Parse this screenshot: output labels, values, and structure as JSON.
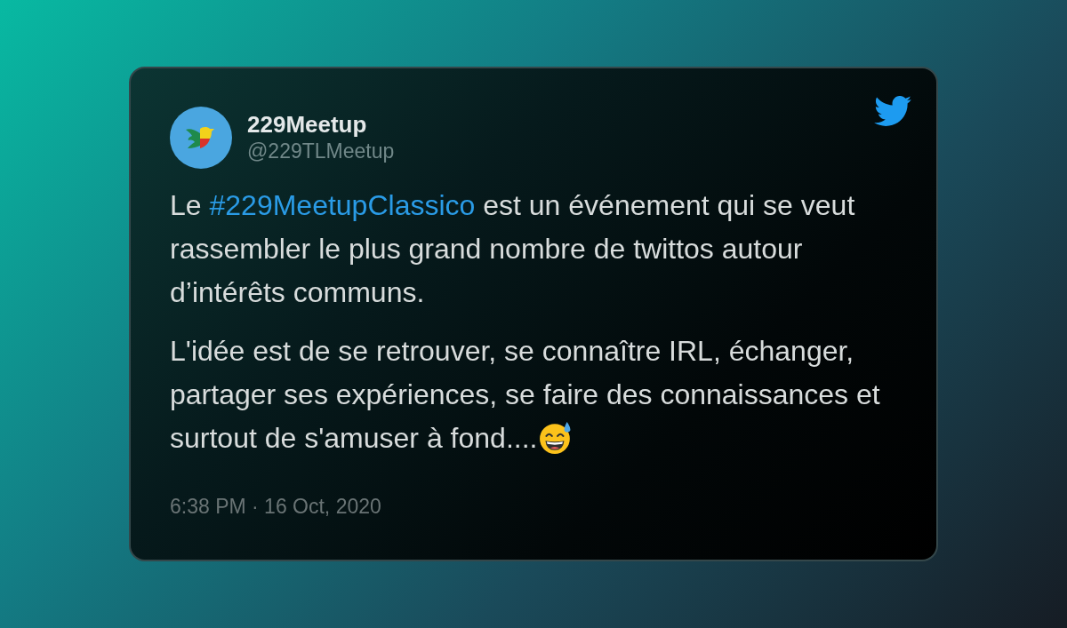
{
  "tweet": {
    "author": {
      "name": "229Meetup",
      "handle": "@229TLMeetup"
    },
    "paragraphs": [
      {
        "parts": [
          {
            "kind": "text",
            "text": "Le "
          },
          {
            "kind": "hashtag",
            "text": "#229MeetupClassico"
          },
          {
            "kind": "text",
            "text": " est un événement qui se veut rassembler le plus grand nombre de twittos autour d’intérêts communs."
          }
        ]
      },
      {
        "parts": [
          {
            "kind": "text",
            "text": "L'idée est de se retrouver, se connaître IRL, échanger, partager ses expériences, se faire des connaissances et surtout de s'amuser à fond...."
          },
          {
            "kind": "emoji"
          }
        ]
      }
    ],
    "timestamp": "6:38 PM · 16 Oct, 2020"
  }
}
